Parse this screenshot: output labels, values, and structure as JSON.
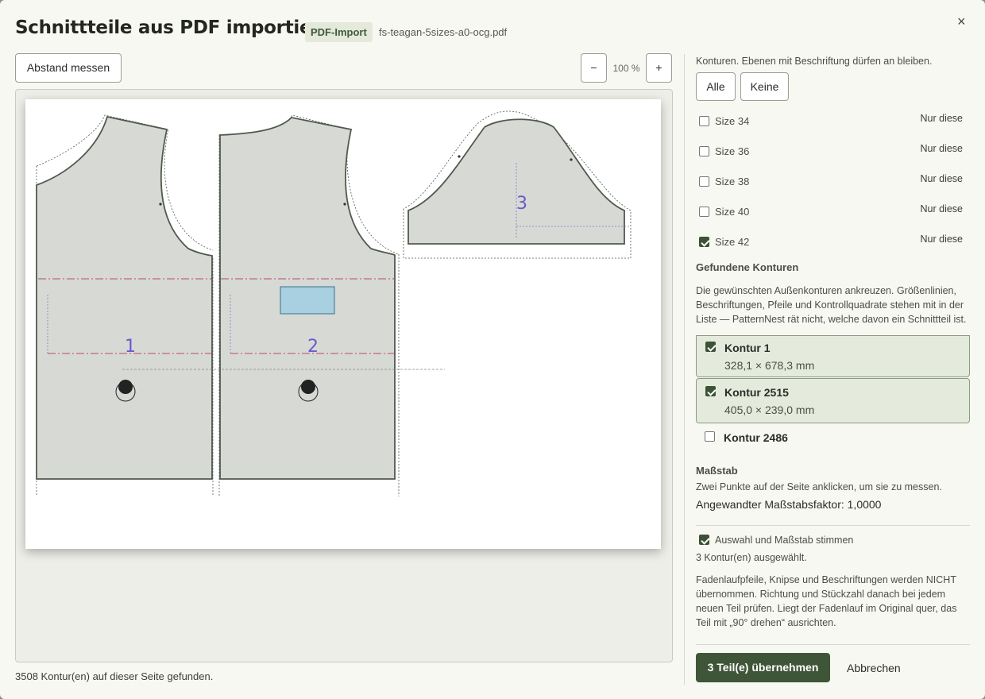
{
  "header": {
    "title": "Schnittteile aus PDF importieren",
    "badge": "PDF-Import",
    "filename": "fs-teagan-5sizes-a0-ocg.pdf",
    "close": "×"
  },
  "toolbar": {
    "measure_label": "Abstand messen",
    "zoom_out": "−",
    "zoom_in": "+",
    "zoom_level": "100 %"
  },
  "canvas": {
    "pieces": [
      {
        "number": "1"
      },
      {
        "number": "2"
      },
      {
        "number": "3"
      }
    ],
    "footer": "3508 Kontur(en) auf dieser Seite gefunden."
  },
  "layers": {
    "intro": "Konturen. Ebenen mit Beschriftung dürfen an bleiben.",
    "all_label": "Alle",
    "none_label": "Keine",
    "only_label": "Nur diese",
    "sizes": [
      {
        "label": "Size 34",
        "checked": false
      },
      {
        "label": "Size 36",
        "checked": false
      },
      {
        "label": "Size 38",
        "checked": false
      },
      {
        "label": "Size 40",
        "checked": false
      },
      {
        "label": "Size 42",
        "checked": true
      }
    ]
  },
  "contours": {
    "heading": "Gefundene Konturen",
    "description": "Die gewünschten Außenkonturen ankreuzen. Größenlinien, Beschriftungen, Pfeile und Kontrollquadrate stehen mit in der Liste — PatternNest rät nicht, welche davon ein Schnittteil ist.",
    "items": [
      {
        "name": "Kontur 1",
        "dims": "328,1 × 678,3 mm",
        "checked": true
      },
      {
        "name": "Kontur 2515",
        "dims": "405,0 × 239,0 mm",
        "checked": true
      },
      {
        "name": "Kontur 2486",
        "dims": "",
        "checked": false
      }
    ]
  },
  "scale": {
    "heading": "Maßstab",
    "hint": "Zwei Punkte auf der Seite anklicken, um sie zu messen.",
    "applied": "Angewandter Maßstabsfaktor: 1,0000"
  },
  "confirm": {
    "label": "Auswahl und Maßstab stimmen",
    "checked": true,
    "selected_count": "3 Kontur(en) ausgewählt.",
    "note": "Fadenlaufpfeile, Knipse und Beschriftungen werden NICHT übernommen. Richtung und Stückzahl danach bei jedem neuen Teil prüfen. Liegt der Fadenlauf im Original quer, das Teil mit „90° drehen“ ausrichten."
  },
  "actions": {
    "primary": "3 Teil(e) übernehmen",
    "cancel": "Abbrechen"
  }
}
